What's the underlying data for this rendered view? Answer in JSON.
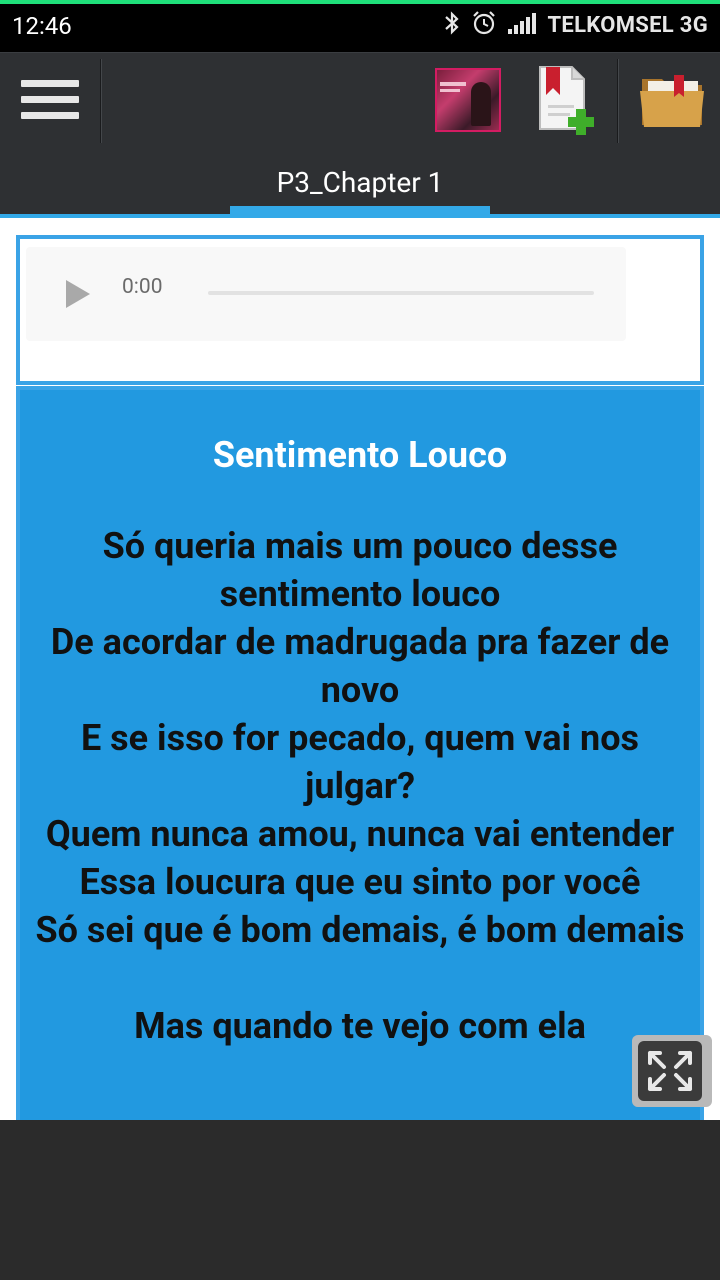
{
  "status_bar": {
    "time": "12:46",
    "carrier": "TELKOMSEL 3G",
    "icons": [
      "bluetooth-icon",
      "alarm-icon",
      "signal-icon"
    ]
  },
  "toolbar": {
    "menu_icon": "hamburger-menu-icon",
    "album_thumbnail_icon": "album-cover-thumbnail",
    "bookmark_add_icon": "bookmark-add-icon",
    "folder_icon": "bookmark-folder-icon"
  },
  "tabs": [
    {
      "label": "P3_Chapter 1",
      "active": true
    }
  ],
  "audio_player": {
    "current_time": "0:00",
    "play_icon": "play-icon",
    "progress": 0
  },
  "lyrics": {
    "title": "Sentimento Louco",
    "lines": [
      "Só queria mais um pouco desse sentimento louco",
      "De acordar de madrugada pra fazer de novo",
      "E se isso for pecado, quem vai nos julgar?",
      "Quem nunca amou, nunca vai entender",
      "Essa loucura que eu sinto por você",
      "Só sei que é bom demais, é bom demais",
      "",
      "Mas quando te vejo com ela"
    ]
  },
  "fullscreen_button": {
    "icon": "expand-fullscreen-icon"
  },
  "colors": {
    "accent_blue": "#33a9e8",
    "lyrics_background": "#2299e0",
    "toolbar_background": "#2e3033",
    "status_accent": "#1fe07a"
  }
}
